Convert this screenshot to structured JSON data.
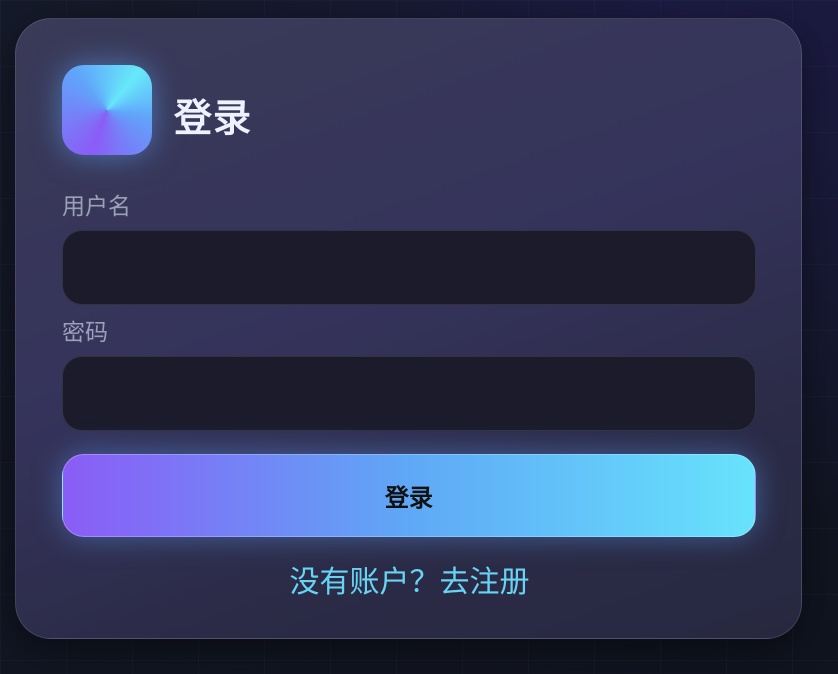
{
  "login": {
    "title": "登录",
    "username_label": "用户名",
    "username_value": "",
    "username_placeholder": "",
    "password_label": "密码",
    "password_value": "",
    "password_placeholder": "",
    "submit_label": "登录",
    "register_prompt": "没有账户？",
    "register_link": "去注册"
  },
  "colors": {
    "accent_start": "#8b5cf6",
    "accent_end": "#67e3fc",
    "link": "#67d4f5",
    "card_bg": "#35335b",
    "input_bg": "#1b1b2b"
  },
  "icons": {
    "logo": "app-logo-icon"
  }
}
